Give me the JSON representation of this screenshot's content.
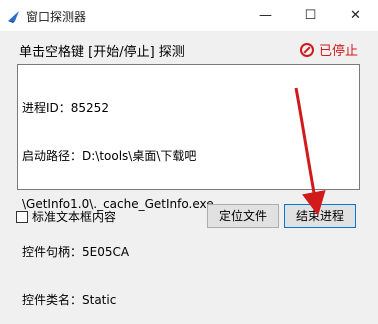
{
  "window": {
    "title": "窗口探测器"
  },
  "header": {
    "instruction": "单击空格键 [开始/停止] 探测",
    "status_label": "已停止"
  },
  "info": {
    "lines": [
      "进程ID：85252",
      "启动路径：D:\\tools\\桌面\\下载吧",
      "\\GetInfo1.0\\._cache_GetInfo.exe",
      "控件句柄：5E05CA",
      "控件类名：Static"
    ]
  },
  "footer": {
    "checkbox_label": "标准文本框内容",
    "locate_button": "定位文件",
    "end_button": "结束进程"
  },
  "colors": {
    "status": "#d11b1b",
    "arrow": "#d11b1b",
    "focus_border": "#0078d7"
  },
  "icons": {
    "app": "app-icon",
    "status": "stop-circle-icon"
  }
}
